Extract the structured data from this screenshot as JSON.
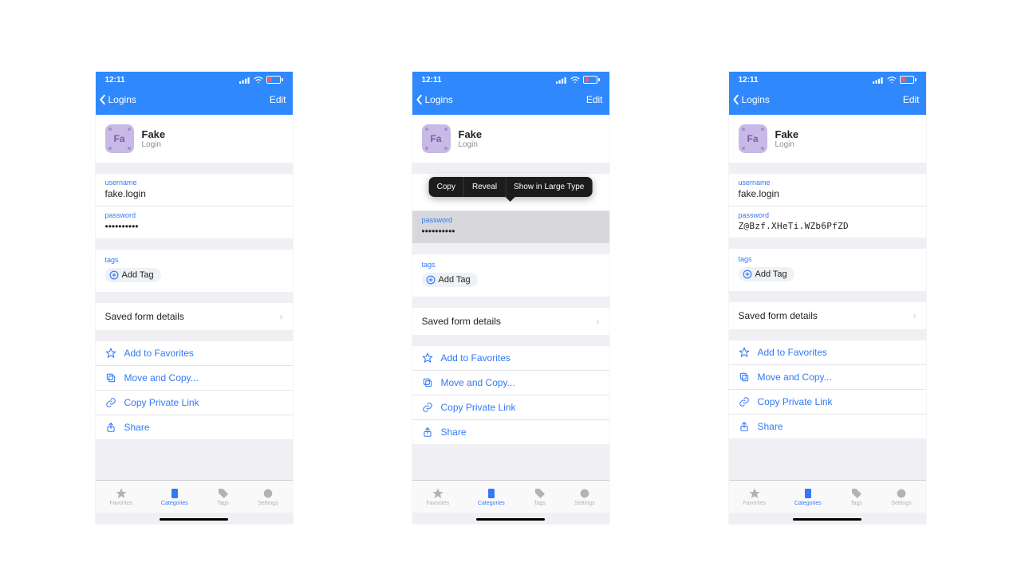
{
  "status": {
    "time": "12:11"
  },
  "nav": {
    "back_label": "Logins",
    "edit_label": "Edit"
  },
  "item": {
    "title": "Fake",
    "subtitle": "Login",
    "icon_monogram": "Fa"
  },
  "fields": {
    "username_label": "username",
    "username_value": "fake.login",
    "password_label": "password",
    "password_masked": "••••••••••",
    "password_revealed": "Z@Bzf.XHeTi.WZb6PfZD"
  },
  "tags": {
    "label": "tags",
    "add_label": "Add Tag"
  },
  "rows": {
    "saved_form": "Saved form details"
  },
  "actions": {
    "favorites": "Add to Favorites",
    "move_copy": "Move and Copy...",
    "copy_link": "Copy Private Link",
    "share": "Share"
  },
  "popover": {
    "copy": "Copy",
    "reveal": "Reveal",
    "large": "Show in Large Type"
  },
  "tabs": {
    "favorites": "Favorites",
    "categories": "Categories",
    "tags": "Tags",
    "settings": "Settings"
  }
}
